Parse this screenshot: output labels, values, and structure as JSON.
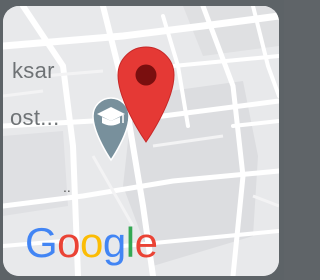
{
  "map": {
    "place_label_line1": "ksar",
    "place_label_line2": "ost...",
    "dots": "..",
    "pin_color": "#e53935",
    "pin_dot_color": "#7a0f0f",
    "school_icon_color": "#78909c",
    "school_icon": "school-graduation-cap-icon",
    "selected_pin_icon": "location-pin-icon"
  },
  "logo": {
    "letters": [
      "G",
      "o",
      "o",
      "g",
      "l",
      "e"
    ],
    "colors": [
      "#4285f4",
      "#ea4335",
      "#fbbc05",
      "#4285f4",
      "#34a853",
      "#ea4335"
    ]
  }
}
